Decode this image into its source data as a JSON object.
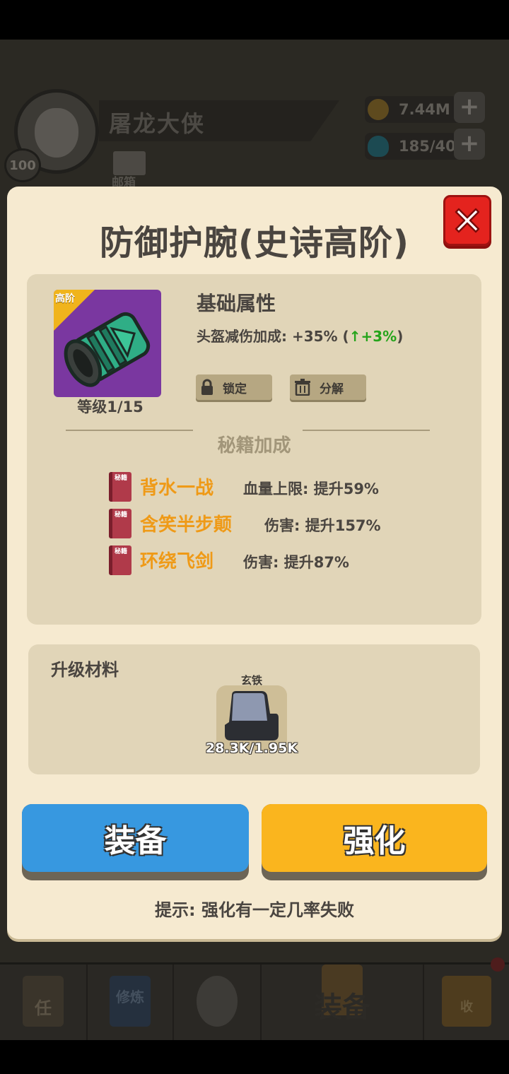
{
  "background": {
    "player_name": "屠龙大侠",
    "player_level": "100",
    "mail_label": "邮箱",
    "coins": "7.44M",
    "gems": "185/40",
    "bottom_nav": [
      {
        "label": "任"
      },
      {
        "label": "修炼"
      },
      {
        "label": ""
      },
      {
        "label": "装备"
      },
      {
        "label": "收"
      }
    ]
  },
  "modal": {
    "title": "防御护腕(史诗高阶)",
    "item": {
      "tier_label": "高阶",
      "level": "等级1/15"
    },
    "base_attributes": {
      "heading": "基础属性",
      "line_prefix": "头盔减伤加成: +35% (",
      "bonus": "+3%",
      "line_suffix": ")"
    },
    "lock_label": "锁定",
    "decompose_label": "分解",
    "manual_section_title": "秘籍加成",
    "manuals": [
      {
        "book_label": "秘籍",
        "name": "背水一战",
        "effect": "血量上限: 提升59%"
      },
      {
        "book_label": "秘籍",
        "name": "含笑半步颠",
        "effect": "伤害: 提升157%"
      },
      {
        "book_label": "秘籍",
        "name": "环绕飞剑",
        "effect": "伤害: 提升87%"
      }
    ],
    "materials": {
      "heading": "升级材料",
      "items": [
        {
          "name": "玄铁",
          "count": "28.3K/1.95K"
        }
      ]
    },
    "equip_label": "装备",
    "upgrade_label": "强化",
    "hint": "提示: 强化有一定几率失败"
  },
  "colors": {
    "panel_bg": "#f6ead0",
    "inner_panel": "#e1d5b8",
    "equip_blue": "#3798e0",
    "upgrade_orange": "#fab51e",
    "manual_orange": "#ef9a17",
    "bonus_green": "#25a41b",
    "close_red": "#e4231e",
    "epic_purple": "#7a37a0"
  }
}
